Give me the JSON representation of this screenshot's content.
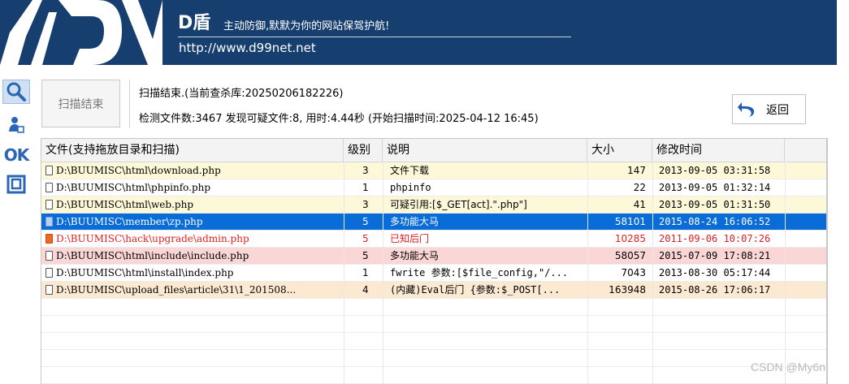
{
  "header": {
    "brand": "D盾",
    "slogan": "主动防御,默默为你的网站保驾护航!",
    "url": "http://www.d99net.net"
  },
  "sidebar": [
    {
      "name": "search-icon",
      "selected": true
    },
    {
      "name": "user-icon"
    },
    {
      "name": "ok-icon",
      "text": "OK"
    },
    {
      "name": "window-icon"
    }
  ],
  "toolbar": {
    "scan_button": "扫描结束",
    "status_line1": "扫描结束.(当前查杀库:20250206182226)",
    "status_line2": "检测文件数:3467 发现可疑文件:8, 用时:4.44秒 (开始扫描时间:2025-04-12 16:45)",
    "back_button": "返回"
  },
  "table": {
    "columns": [
      "文件(支持拖放目录和扫描)",
      "级别",
      "说明",
      "大小",
      "修改时间"
    ],
    "rows": [
      {
        "file": "D:\\BUUMISC\\html\\download.php",
        "level": "3",
        "desc": "文件下载",
        "size": "147",
        "mtime": "2013-09-05 03:31:58",
        "style": "warn"
      },
      {
        "file": "D:\\BUUMISC\\html\\phpinfo.php",
        "level": "1",
        "desc": "phpinfo",
        "size": "22",
        "mtime": "2013-09-05 01:32:14",
        "style": "normal"
      },
      {
        "file": "D:\\BUUMISC\\html\\web.php",
        "level": "3",
        "desc": "可疑引用:[$_GET[act].\".php\"]",
        "size": "41",
        "mtime": "2013-09-05 01:31:50",
        "style": "warn"
      },
      {
        "file": "D:\\BUUMISC\\member\\zp.php",
        "level": "5",
        "desc": "多功能大马",
        "size": "58101",
        "mtime": "2015-08-24 16:06:52",
        "style": "selected"
      },
      {
        "file": "D:\\BUUMISC\\hack\\upgrade\\admin.php",
        "level": "5",
        "desc": "已知后门",
        "size": "10285",
        "mtime": "2011-09-06 10:07:26",
        "style": "danger"
      },
      {
        "file": "D:\\BUUMISC\\html\\include\\include.php",
        "level": "5",
        "desc": "多功能大马",
        "size": "58057",
        "mtime": "2015-07-09 17:08:21",
        "style": "high"
      },
      {
        "file": "D:\\BUUMISC\\html\\install\\index.php",
        "level": "1",
        "desc": "fwrite 参数:[$file_config,\"/...",
        "size": "7043",
        "mtime": "2013-08-30 05:17:44",
        "style": "normal"
      },
      {
        "file": "D:\\BUUMISC\\upload_files\\article\\31\\1_201508...",
        "level": "4",
        "desc": "(内藏)Eval后门 {参数:$_POST[...",
        "size": "163948",
        "mtime": "2015-08-26 17:06:17",
        "style": "medium"
      }
    ]
  },
  "colors": {
    "banner": "#163e6e",
    "selected_row": "#0a6cd6",
    "warn_row": "#fdf8d8",
    "danger_text": "#e02020",
    "high_row": "#fbd6d6",
    "medium_row": "#fbe9d2"
  },
  "watermark": "CSDN @My6n"
}
